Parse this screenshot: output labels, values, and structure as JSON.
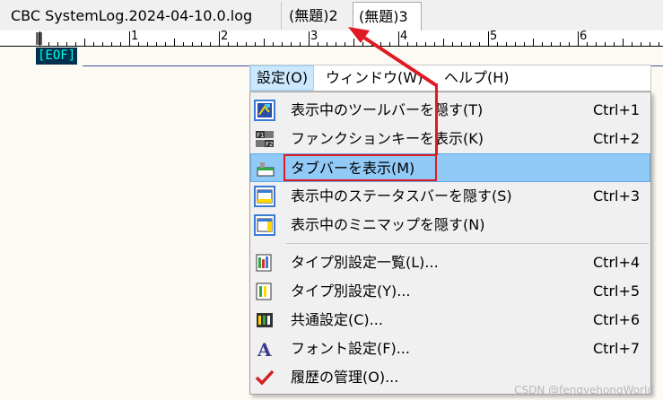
{
  "tabs": [
    {
      "label": "CBC SystemLog.2024-04-10.0.log"
    },
    {
      "label": "(無題)2"
    },
    {
      "label": "(無題)3"
    }
  ],
  "ruler": {
    "numbers": [
      "1",
      "2",
      "3",
      "4",
      "5",
      "6"
    ],
    "start_marker": "0"
  },
  "editor": {
    "eof": "[EOF]"
  },
  "menubar": {
    "items": [
      {
        "label": "設定(O)"
      },
      {
        "label": "ウィンドウ(W)"
      },
      {
        "label": "ヘルプ(H)"
      }
    ]
  },
  "menu": {
    "items": [
      {
        "label": "表示中のツールバーを隠す(T)",
        "shortcut": "Ctrl+1",
        "icon": "toolbar-icon"
      },
      {
        "label": "ファンクションキーを表示(K)",
        "shortcut": "Ctrl+2",
        "icon": "function-keys-icon"
      },
      {
        "label": "タブバーを表示(M)",
        "shortcut": "",
        "icon": "tabbar-icon"
      },
      {
        "label": "表示中のステータスバーを隠す(S)",
        "shortcut": "Ctrl+3",
        "icon": "statusbar-icon"
      },
      {
        "label": "表示中のミニマップを隠す(N)",
        "shortcut": "",
        "icon": "minimap-icon"
      },
      {
        "label": "タイプ別設定一覧(L)...",
        "shortcut": "Ctrl+4",
        "icon": "type-settings-list-icon"
      },
      {
        "label": "タイプ別設定(Y)...",
        "shortcut": "Ctrl+5",
        "icon": "type-settings-icon"
      },
      {
        "label": "共通設定(C)...",
        "shortcut": "Ctrl+6",
        "icon": "common-settings-icon"
      },
      {
        "label": "フォント設定(F)...",
        "shortcut": "Ctrl+7",
        "icon": "font-icon"
      },
      {
        "label": "履歴の管理(O)...",
        "shortcut": "",
        "icon": "checkmark-icon"
      }
    ]
  },
  "watermark": "CSDN @fengyehongWorld",
  "colors": {
    "annotation_red": "#e01a22",
    "highlight": "#91c9f7",
    "eof_bg": "#003050",
    "eof_fg": "#00ffe0"
  }
}
